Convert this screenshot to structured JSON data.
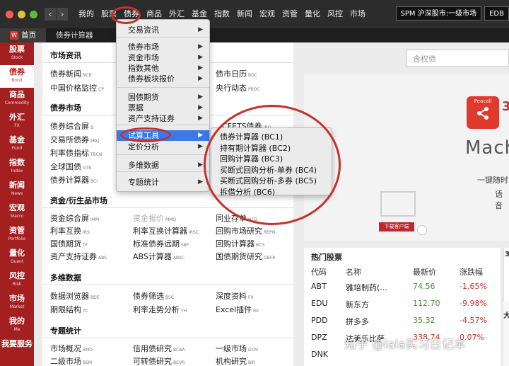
{
  "top_menu": [
    "我的",
    "股票",
    "债券",
    "商品",
    "外汇",
    "基金",
    "指数",
    "新闻",
    "宏观",
    "资管",
    "量化",
    "风控",
    "市场"
  ],
  "top_right": {
    "market_pill": "SPM 沪深股市:一级市场",
    "edb_pill": "EDB"
  },
  "tabs": {
    "home": "首页",
    "home_badge": "W",
    "bond_calc": "债券计算器"
  },
  "sidebar": [
    {
      "cn": "股票",
      "en": "Stock"
    },
    {
      "cn": "债券",
      "en": "Bond"
    },
    {
      "cn": "商品",
      "en": "Commodity"
    },
    {
      "cn": "外汇",
      "en": "FX"
    },
    {
      "cn": "基金",
      "en": "Fund"
    },
    {
      "cn": "指数",
      "en": "Index"
    },
    {
      "cn": "新闻",
      "en": "News"
    },
    {
      "cn": "宏观",
      "en": "Macro"
    },
    {
      "cn": "资管",
      "en": "Portfolio"
    },
    {
      "cn": "量化",
      "en": "Quant"
    },
    {
      "cn": "风控",
      "en": "Risk"
    },
    {
      "cn": "市场",
      "en": "Market"
    },
    {
      "cn": "我的",
      "en": "Me"
    },
    {
      "cn": "我要服务",
      "en": ""
    }
  ],
  "sections": {
    "market_info": "市场资讯",
    "bond_market": "债券市场",
    "assets_derivatives": "资金/衍生品市场",
    "multi_data": "多维数据",
    "special_stats": "专题统计"
  },
  "links": {
    "bond_news": "债券新闻",
    "bond_news_code": "NCB",
    "cn_price": "中国价格监控",
    "cn_price_code": "CP",
    "bond_calendar": "债市日历",
    "bond_calendar_code": "BDC",
    "central_bank": "央行动态",
    "central_bank_code": "PBOC",
    "bond_screen": "债券综合屏",
    "bond_screen_code": "B",
    "exchange_bond": "交易所债券",
    "exchange_bond_code": "EBQ",
    "rate_bond": "利率债指标",
    "rate_bond_code": "TBCN",
    "global_bond": "全球国债",
    "global_bond_code": "GTB",
    "bond_calc": "债券计算器",
    "bond_calc_code": "BCI",
    "cfets": "CFETS债券",
    "cfets_code": "IBQ",
    "fund_screen": "资金综合屏",
    "fund_screen_code": "IMM",
    "fund_quote": "资金报价",
    "fund_quote_code": "MMQ",
    "interbank": "同业存单",
    "interbank_code": "NCD",
    "irs": "利率互换",
    "irs_code": "IRS",
    "irs_calc": "利率互换计算器",
    "irs_calc_code": "IRSC",
    "repo_research": "回购市场研究",
    "repo_research_code": "REPO",
    "futures": "国债期货",
    "futures_code": "TF",
    "bond_forward": "标准债券远期",
    "bond_forward_code": "SBF",
    "repo_calc": "回购计算器",
    "repo_calc_code": "BC3",
    "abs": "资产支持证券",
    "abs_code": "ABS",
    "abs_calc": "ABS计算器",
    "abs_calc_code": "ABSC",
    "futures_research": "国债期货研究",
    "futures_research_code": "GBFR",
    "data_browser": "数据浏览器",
    "data_browser_code": "BDE",
    "bond_filter": "债券筛选",
    "bond_filter_code": "BSC",
    "deep_data": "深度资料",
    "deep_data_code": "F9",
    "term_structure": "期限结构",
    "term_structure_code": "YC",
    "rate_trend": "利率走势分析",
    "rate_trend_code": "YH",
    "excel_plugin": "Excel插件",
    "excel_plugin_code": "RE",
    "market_overview": "市场概况",
    "market_overview_code": "BMO",
    "credit_research": "信用债研究",
    "credit_research_code": "BCBA",
    "primary_market": "一级市场",
    "primary_market_code": "DCM",
    "row6a": "二级市场",
    "row6a_code": "BSM",
    "row6b": "可转债研究",
    "row6b_code": "BCVR",
    "row6c": "机构研究",
    "row6c_code": "BIR"
  },
  "dropdown": {
    "items": [
      "交易资讯",
      "债券市场",
      "资金市场",
      "指数其他",
      "债券板块报价",
      "国债期货",
      "票据",
      "资产支持证券",
      "试算工具",
      "定价分析",
      "多维数据",
      "专题统计"
    ]
  },
  "submenu": [
    "债券计算器 (BC1)",
    "持有期计算器 (BC2)",
    "回购计算器 (BC3)",
    "买断式回购分析-单券 (BC4)",
    "买断式回购分析-多券 (BC5)",
    "拆借分析 (BC6)"
  ],
  "search": {
    "placeholder": "含权债"
  },
  "banner": {
    "brand": "Peacall",
    "big_text": "Mach",
    "sub1": "一键随时",
    "sub2": "语音",
    "download": "下载客户端"
  },
  "hot_stocks": {
    "title": "热门股票",
    "headers": [
      "代码",
      "名称",
      "最新价",
      "涨跌幅"
    ],
    "rows": [
      {
        "code": "ABT",
        "name": "雅培制药(...",
        "price": "74.56",
        "change": "-1.65%"
      },
      {
        "code": "EDU",
        "name": "新东方",
        "price": "112.70",
        "change": "-9.98%"
      },
      {
        "code": "PDD",
        "name": "拼多多",
        "price": "35.32",
        "change": "-4.57%"
      },
      {
        "code": "DPZ",
        "name": "达美乐比萨",
        "price": "338.74",
        "change": "0.07%"
      },
      {
        "code": "DNK",
        "name": "",
        "price": "",
        "change": ""
      }
    ]
  },
  "right_edge": {
    "num": "3",
    "char": "大"
  },
  "watermark": "知乎 @lala实习日记本",
  "colors": {
    "brand_red": "#a41f1f",
    "highlight_blue": "#3b79e6",
    "ring_red": "#c6312c"
  }
}
